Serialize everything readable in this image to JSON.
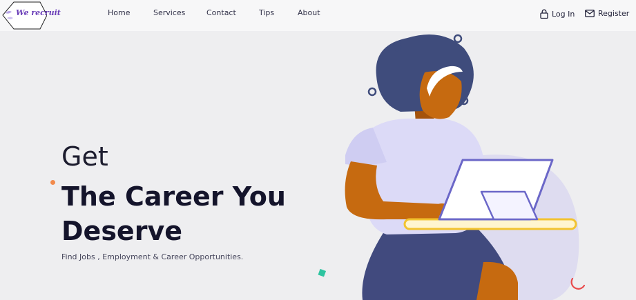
{
  "brand": {
    "logo_text": "We recruit"
  },
  "nav": {
    "home": "Home",
    "services": "Services",
    "contact": "Contact",
    "tips": "Tips",
    "about": "About"
  },
  "auth": {
    "login": "Log In",
    "register": "Register"
  },
  "hero": {
    "pre": "Get",
    "title": "The Career You Deserve",
    "subtitle": "Find Jobs , Employment & Career Opportunities."
  },
  "icons": {
    "login": "lock-icon",
    "register": "envelope-icon"
  },
  "colors": {
    "accent_purple": "#6b3fb8",
    "hero_text": "#14142b",
    "background": "#eeeef0",
    "skin": "#c66a10",
    "hair": "#3f4c7c",
    "shirt": "#dcdaf7",
    "desk_yellow": "#f2c32f"
  }
}
